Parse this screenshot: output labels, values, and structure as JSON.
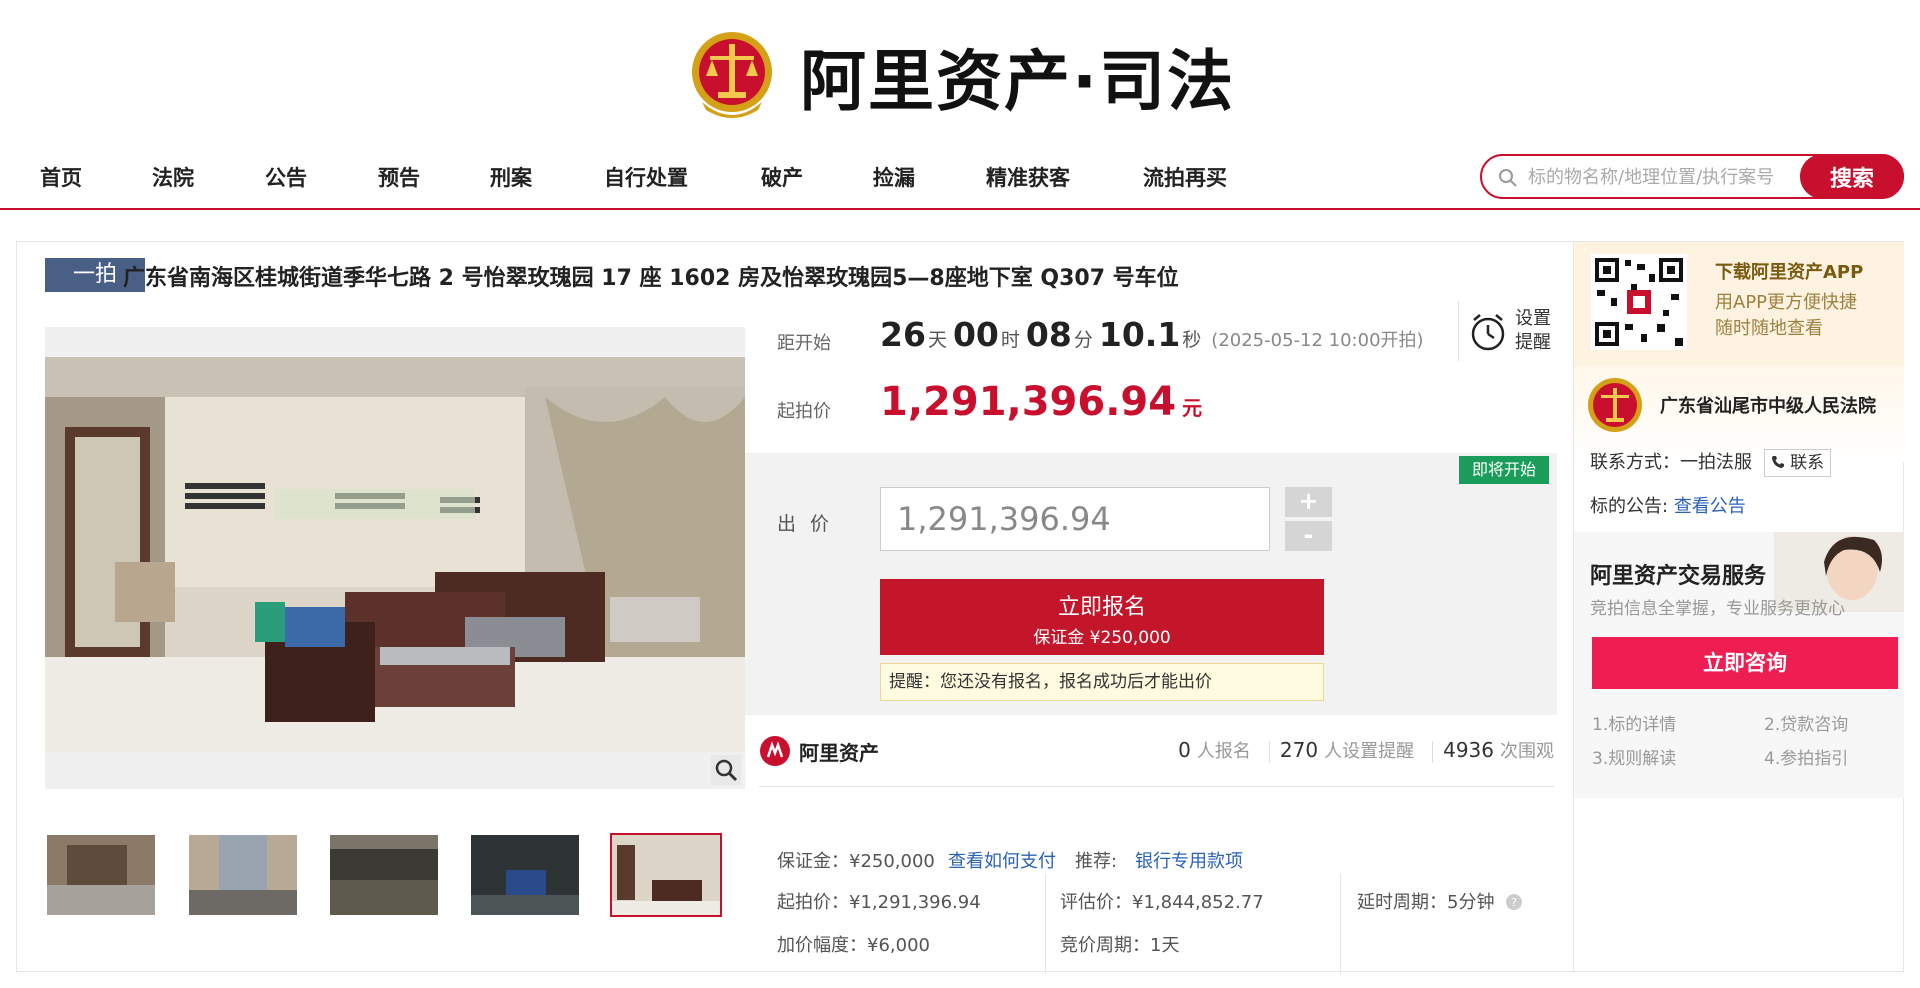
{
  "header": {
    "brand": "阿里资产·司法",
    "nav": [
      "首页",
      "法院",
      "公告",
      "预告",
      "刑案",
      "自行处置",
      "破产",
      "捡漏",
      "精准获客",
      "流拍再买"
    ],
    "search_placeholder": "标的物名称/地理位置/执行案号",
    "search_button": "搜索"
  },
  "item": {
    "tag": "一拍",
    "title": "广东省南海区桂城街道季华七路 2 号怡翠玫瑰园 17 座 1602 房及怡翠玫瑰园5—8座地下室 Q307 号车位",
    "thumbnail_count": 5,
    "active_thumbnail": 5
  },
  "bid": {
    "countdown_label": "距开始",
    "countdown": {
      "days": "26",
      "day_unit": "天",
      "hours": "00",
      "hour_unit": "时",
      "minutes": "08",
      "minute_unit": "分",
      "seconds": "10.1",
      "second_unit": "秒"
    },
    "start_note": "(2025-05-12 10:00开拍)",
    "reminder": "设置提醒",
    "start_price_label": "起拍价",
    "start_price": "1,291,396.94",
    "start_price_unit": "元",
    "status_badge": "即将开始",
    "offer_label": "出 价",
    "offer_value": "1,291,396.94",
    "plus": "+",
    "minus": "-",
    "signup_main": "立即报名",
    "signup_sub": "保证金 ¥250,000",
    "tip": "提醒：您还没有报名，报名成功后才能出价"
  },
  "stats": {
    "brand": "阿里资产",
    "signups": "0",
    "signups_label": "人报名",
    "reminders": "270",
    "reminders_label": "人设置提醒",
    "views": "4936",
    "views_label": "次围观"
  },
  "info": {
    "deposit": "保证金：¥250,000",
    "how_to_pay": "查看如何支付",
    "recommend_label": "推荐:",
    "recommend_link": "银行专用款项",
    "start_price": "起拍价：¥1,291,396.94",
    "appraisal": "评估价：¥1,844,852.77",
    "delay": "延时周期：5分钟",
    "increment": "加价幅度：¥6,000",
    "bid_period": "竞价周期：1天"
  },
  "sidebar": {
    "app_title": "下载阿里资产APP",
    "app_desc_1": "用APP更方便快捷",
    "app_desc_2": "随时随地查看",
    "court": "广东省汕尾市中级人民法院",
    "contact_label": "联系方式：一拍法服",
    "contact_button": "联系",
    "notice_label": "标的公告:",
    "notice_link": "查看公告",
    "service_title": "阿里资产交易服务",
    "service_sub": "竞拍信息全掌握，专业服务更放心",
    "consult_button": "立即咨询",
    "links": [
      "1.标的详情",
      "2.贷款咨询",
      "3.规则解读",
      "4.参拍指引"
    ]
  },
  "colors": {
    "accent": "#c8102e",
    "link": "#2a62b8",
    "status_green": "#1a9d5a",
    "tag": "#4a5f86"
  }
}
